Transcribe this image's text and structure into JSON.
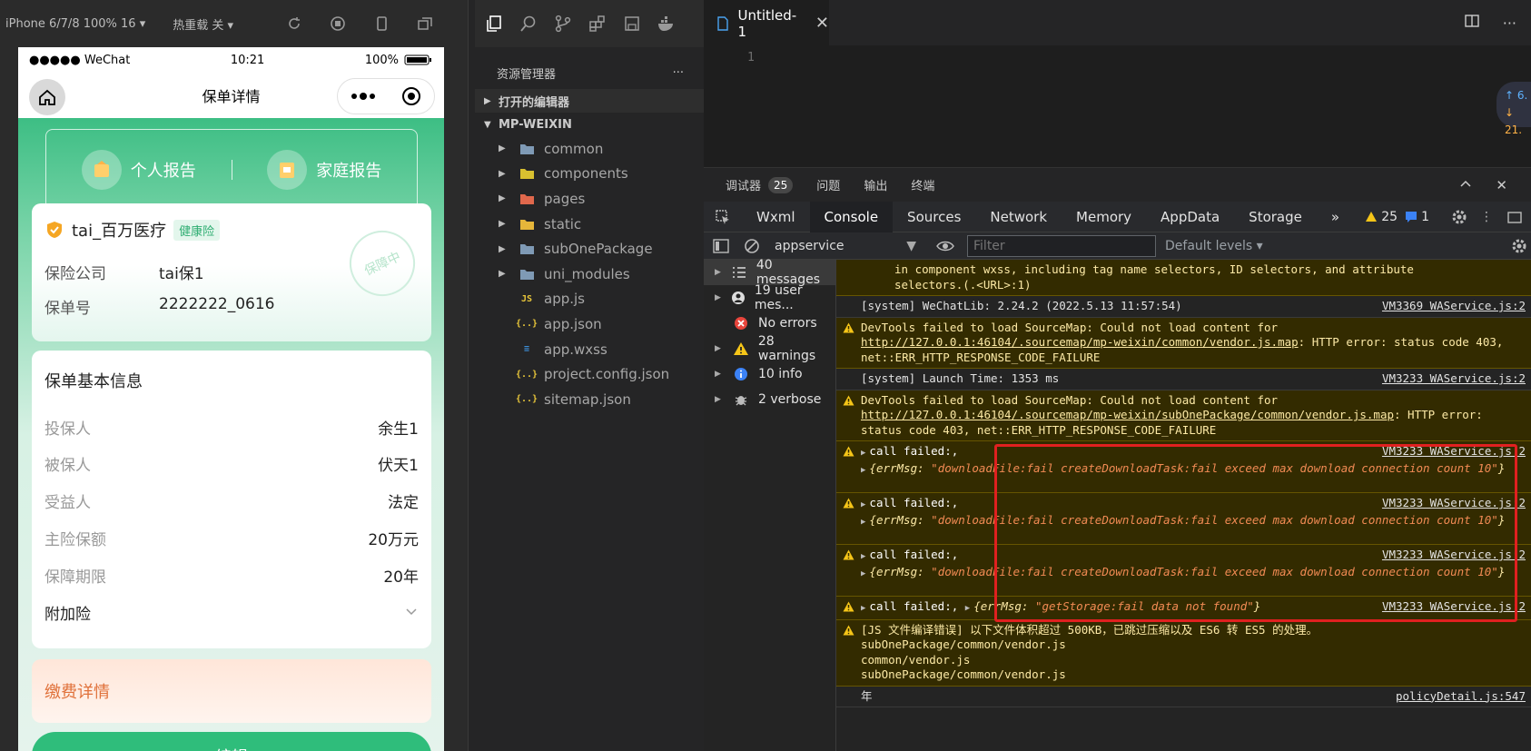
{
  "simulator": {
    "device_label": "iPhone 6/7/8 100% 16 ▾",
    "hotreload_label": "热重载 关 ▾",
    "status": {
      "signal": "●●●●● WeChat",
      "time": "10:21",
      "battery": "100%"
    },
    "nav_title": "保单详情",
    "reports": [
      {
        "label": "个人报告"
      },
      {
        "label": "家庭报告"
      }
    ],
    "policy": {
      "name": "tai_百万医疗",
      "tag": "健康险",
      "stamp": "保障中",
      "company_label": "保险公司",
      "company": "tai保1",
      "number_label": "保单号",
      "number": "2222222_0616"
    },
    "basic_info": {
      "title": "保单基本信息",
      "rows": [
        {
          "k": "投保人",
          "v": "余生1"
        },
        {
          "k": "被保人",
          "v": "伏天1"
        },
        {
          "k": "受益人",
          "v": "法定"
        },
        {
          "k": "主险保额",
          "v": "20万元"
        },
        {
          "k": "保障期限",
          "v": "20年"
        },
        {
          "k": "附加险",
          "v": ""
        }
      ]
    },
    "payment_title": "缴费详情",
    "edit_button": "编辑"
  },
  "explorer": {
    "title": "资源管理器",
    "more": "···",
    "open_editors": "打开的编辑器",
    "project": "MP-WEIXIN",
    "folders": [
      {
        "name": "common",
        "color": "#7f9ab5"
      },
      {
        "name": "components",
        "color": "#d8c030"
      },
      {
        "name": "pages",
        "color": "#e0684c"
      },
      {
        "name": "static",
        "color": "#e6b63a"
      },
      {
        "name": "subOnePackage",
        "color": "#7f9ab5"
      },
      {
        "name": "uni_modules",
        "color": "#7f9ab5"
      }
    ],
    "files": [
      {
        "name": "app.js",
        "icon": "js-icon",
        "glyph": "JS",
        "color": "#e8c63a"
      },
      {
        "name": "app.json",
        "icon": "json-icon",
        "glyph": "{..}",
        "color": "#e8c63a"
      },
      {
        "name": "app.wxss",
        "icon": "css-icon",
        "glyph": "≡",
        "color": "#3d8fd8"
      },
      {
        "name": "project.config.json",
        "icon": "json-icon",
        "glyph": "{..}",
        "color": "#e8c63a"
      },
      {
        "name": "sitemap.json",
        "icon": "json-icon",
        "glyph": "{..}",
        "color": "#e8c63a"
      }
    ]
  },
  "editor": {
    "tab_title": "Untitled-1",
    "line_number": "1",
    "net_up": "↑ 6.",
    "net_down": "↓ 21."
  },
  "devtools": {
    "top_tabs": [
      {
        "label": "调试器",
        "badge": "25"
      },
      {
        "label": "问题"
      },
      {
        "label": "输出"
      },
      {
        "label": "终端"
      }
    ],
    "tabs": [
      {
        "label": "Wxml",
        "active": false
      },
      {
        "label": "Console",
        "active": true
      },
      {
        "label": "Sources",
        "active": false
      },
      {
        "label": "Network",
        "active": false
      },
      {
        "label": "Memory",
        "active": false
      },
      {
        "label": "AppData",
        "active": false
      },
      {
        "label": "Storage",
        "active": false
      }
    ],
    "more_tabs": "»",
    "warn_count": "25",
    "info_count": "1",
    "context": "appservice",
    "filter_placeholder": "Filter",
    "levels": "Default levels ▾",
    "sidebar": [
      {
        "label": "40 messages",
        "icon": "list-icon",
        "expandable": true
      },
      {
        "label": "19 user mes...",
        "icon": "user-icon",
        "expandable": true
      },
      {
        "label": "No errors",
        "icon": "error-icon",
        "expandable": false
      },
      {
        "label": "28 warnings",
        "icon": "warning-icon",
        "expandable": true
      },
      {
        "label": "10 info",
        "icon": "info-icon",
        "expandable": true
      },
      {
        "label": "2 verbose",
        "icon": "bug-icon",
        "expandable": true
      }
    ],
    "log": [
      {
        "type": "plain",
        "lines": [
          "in component wxss, including tag name selectors, ID selectors, and attribute",
          "selectors.(.<URL>:1)"
        ],
        "indent": true,
        "src": ""
      },
      {
        "type": "plain",
        "lines": [
          "[system] WeChatLib: 2.24.2 (2022.5.13 11:57:54)"
        ],
        "src": "VM3369 WAService.js:2"
      },
      {
        "type": "warn",
        "pre": "DevTools failed to load SourceMap: Could not load content for ",
        "link": "http://127.0.0.1:46104/.sourcemap/mp-weixin/common/vendor.js.map",
        "post": ": HTTP error: status code 403, net::ERR_HTTP_RESPONSE_CODE_FAILURE",
        "src": ""
      },
      {
        "type": "plain",
        "lines": [
          "[system] Launch Time: 1353 ms"
        ],
        "src": "VM3233 WAService.js:2"
      },
      {
        "type": "warn",
        "pre": "DevTools failed to load SourceMap: Could not load content for ",
        "link": "http://127.0.0.1:46104/.sourcemap/mp-weixin/subOnePackage/common/vendor.js.map",
        "post": ": HTTP error: status code 403, net::ERR_HTTP_RESPONSE_CODE_FAILURE",
        "src": ""
      },
      {
        "type": "callfail",
        "head": "call failed:,",
        "key": "errMsg",
        "val": "\"downloadFile:fail createDownloadTask:fail exceed max download connection count 10\"",
        "src": "VM3233 WAService.js:2"
      },
      {
        "type": "callfail",
        "head": "call failed:,",
        "key": "errMsg",
        "val": "\"downloadFile:fail createDownloadTask:fail exceed max download connection count 10\"",
        "src": "VM3233 WAService.js:2"
      },
      {
        "type": "callfail",
        "head": "call failed:,",
        "key": "errMsg",
        "val": "\"downloadFile:fail createDownloadTask:fail exceed max download connection count 10\"",
        "src": "VM3233 WAService.js:2"
      },
      {
        "type": "callinline",
        "head": "call failed:,",
        "key": "errMsg",
        "val": "\"getStorage:fail data not found\"",
        "src": "VM3233 WAService.js:2"
      },
      {
        "type": "warnlines",
        "lines": [
          "[JS 文件编译错误] 以下文件体积超过 500KB，已跳过压缩以及 ES6 转 ES5 的处理。",
          "subOnePackage/common/vendor.js",
          "common/vendor.js",
          "subOnePackage/common/vendor.js"
        ],
        "src": ""
      },
      {
        "type": "plain",
        "lines": [
          "年"
        ],
        "src": "policyDetail.js:547"
      }
    ]
  },
  "colors": {
    "accent_green": "#2fbd7b",
    "highlight_red": "#e02020",
    "warn_bg": "#332b00"
  }
}
